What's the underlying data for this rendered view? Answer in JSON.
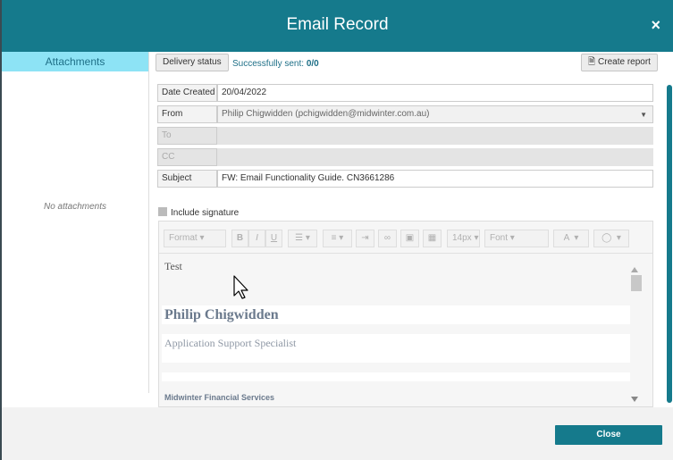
{
  "header": {
    "title": "Email Record",
    "close_icon": "×"
  },
  "sidebar": {
    "tab_label": "Attachments",
    "empty_text": "No attachments"
  },
  "top": {
    "delivery_status_label": "Delivery status",
    "sent_label": "Successfully sent:",
    "sent_value": "0/0",
    "create_report_label": "Create report"
  },
  "fields": {
    "date_created": {
      "label": "Date Created",
      "value": "20/04/2022"
    },
    "from": {
      "label": "From",
      "value": "Philip Chigwidden (pchigwidden@midwinter.com.au)"
    },
    "to": {
      "label": "To",
      "value": ""
    },
    "cc": {
      "label": "CC",
      "value": ""
    },
    "subject": {
      "label": "Subject",
      "value": "FW: Email Functionality Guide. CN3661286"
    }
  },
  "signature": {
    "label": "Include signature",
    "checked": false
  },
  "toolbar": {
    "format": "Format",
    "bold": "B",
    "italic": "I",
    "underline": "U",
    "font_size": "14px",
    "font": "Font",
    "text_color": "A"
  },
  "content": {
    "body_text": "Test",
    "sig_name": "Philip Chigwidden",
    "sig_role": "Application Support Specialist",
    "sig_company": "Midwinter Financial Services"
  },
  "footer": {
    "close_label": "Close"
  },
  "colors": {
    "brand": "#157a8c",
    "tab_active": "#8de3f5"
  }
}
